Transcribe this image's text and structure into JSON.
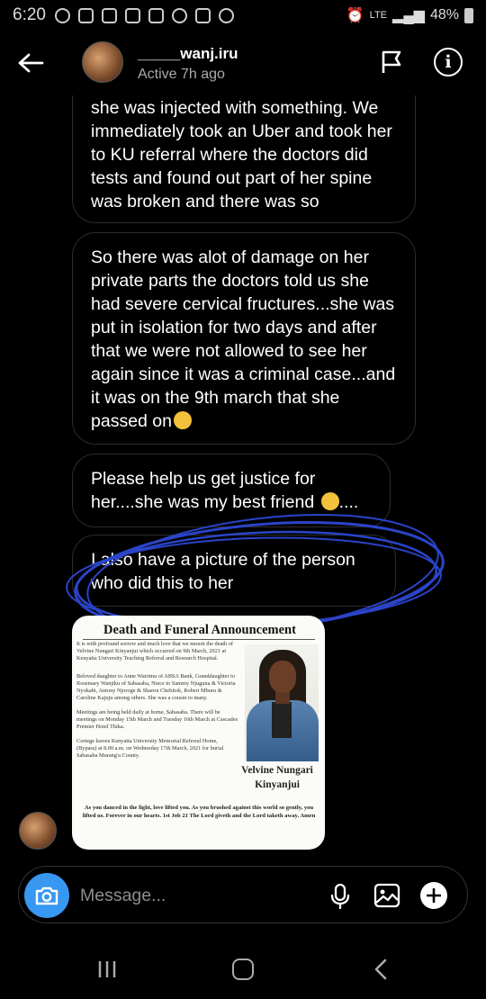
{
  "status_bar": {
    "time": "6:20",
    "network": "LTE",
    "battery": "48%"
  },
  "header": {
    "username": "_____wanj.iru",
    "active_status": "Active 7h ago"
  },
  "messages": [
    "she was injected with something. We immediately took an Uber and took her to KU referral where the doctors did tests and found out part of her spine was broken and there was so",
    "So there was alot of damage on her private parts the doctors told us she had severe cervical fructures...she was put in isolation  for two days and after that we were not allowed to see her again since it was a criminal case...and it was on the 9th march that she passed on",
    "Please help us get justice for her....she was my best friend ",
    "I also have a picture of the person who did this to her"
  ],
  "message_suffix": "....",
  "photo": {
    "title": "Death and Funeral Announcement",
    "para1": "It is with profound sorrow and much love that we mourn the death of Velvine Nungari Kinyanjui which occurred on 9th March, 2021 at Kenyatta University Teaching Referral and Research Hospital.",
    "para2": "Beloved daughter to Anne Wairimu of ABSA Bank, Granddaughter to Rosemary Wanjiku of Sabasaba, Niece to Sammy Njuguna & Victoria Nyokabi, Antony Njoroge & Sharon Chebitok, Robert Mburu & Caroline Kajuju among others. She was a cousin to many.",
    "para3": "Meetings are being held daily at home, Sabasaba. There will be meetings on Monday 15th March and Tuesday 16th March at Cascades Premier Hotel Thika.",
    "para4": "Cortege leaves Kenyatta University Memorial Referral Home, (Bypass) at 8.00 a.m. on Wednesday 17th March, 2021 for burial Sabasaba Murang'a County.",
    "name": "Velvine Nungari Kinyanjui",
    "quote": "As you danced in the light, love lifted you. As you brushed against this world so gently, you lifted us. Forever in our hearts. 1st Job 21 The Lord giveth and the Lord taketh away. Amen"
  },
  "composer": {
    "placeholder": "Message..."
  },
  "colors": {
    "accent": "#3897f0",
    "bubble_border": "#2c2c2c",
    "scribble": "#2a44c8"
  }
}
